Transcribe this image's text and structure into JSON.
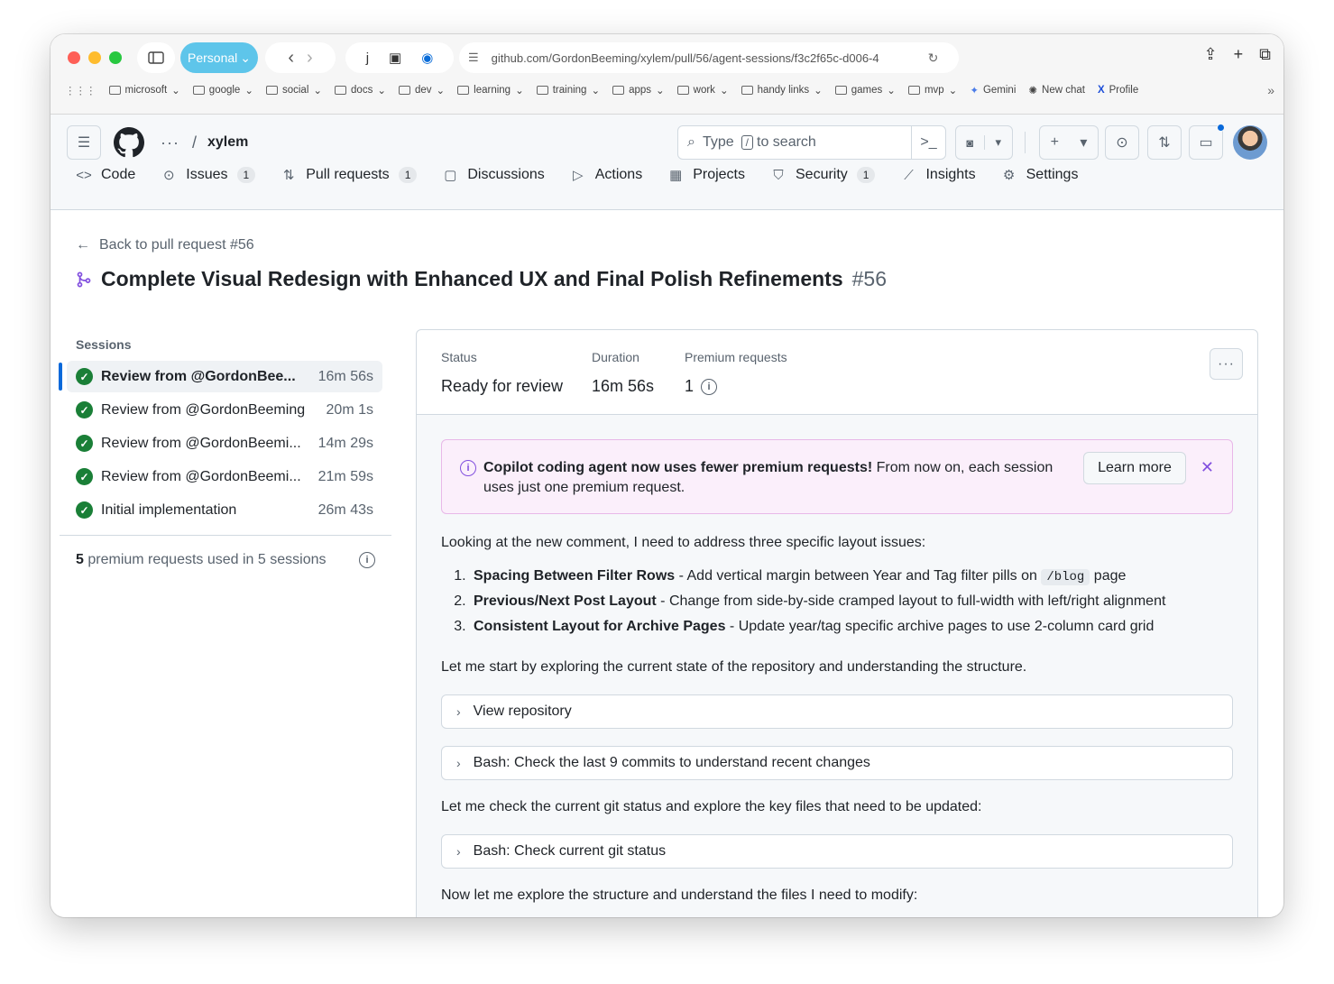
{
  "browser": {
    "profile": "Personal",
    "url": "github.com/GordonBeeming/xylem/pull/56/agent-sessions/f3c2f65c-d006-4",
    "ext_letter": "j",
    "bookmarks": [
      "microsoft",
      "google",
      "social",
      "docs",
      "dev",
      "learning",
      "training",
      "apps",
      "work",
      "handy links",
      "games",
      "mvp"
    ],
    "links": [
      "Gemini",
      "New chat",
      "Profile"
    ]
  },
  "header": {
    "repo": "xylem",
    "search_placeholder_pre": "Type",
    "search_key": "/",
    "search_placeholder_post": "to search",
    "tabs": [
      {
        "label": "Code",
        "icon": "code-icon",
        "count": ""
      },
      {
        "label": "Issues",
        "icon": "issue-icon",
        "count": "1"
      },
      {
        "label": "Pull requests",
        "icon": "pull-request-icon",
        "count": "1"
      },
      {
        "label": "Discussions",
        "icon": "discussion-icon",
        "count": ""
      },
      {
        "label": "Actions",
        "icon": "play-icon",
        "count": ""
      },
      {
        "label": "Projects",
        "icon": "table-icon",
        "count": ""
      },
      {
        "label": "Security",
        "icon": "shield-icon",
        "count": "1"
      },
      {
        "label": "Insights",
        "icon": "graph-icon",
        "count": ""
      },
      {
        "label": "Settings",
        "icon": "gear-icon",
        "count": ""
      }
    ]
  },
  "page": {
    "back_link": "Back to pull request #56",
    "title": "Complete Visual Redesign with Enhanced UX and Final Polish Refinements",
    "number": "#56"
  },
  "sessions": {
    "title": "Sessions",
    "items": [
      {
        "label": "Review from @GordonBee...",
        "time": "16m 56s"
      },
      {
        "label": "Review from @GordonBeeming",
        "time": "20m 1s"
      },
      {
        "label": "Review from @GordonBeemi...",
        "time": "14m 29s"
      },
      {
        "label": "Review from @GordonBeemi...",
        "time": "21m 59s"
      },
      {
        "label": "Initial implementation",
        "time": "26m 43s"
      }
    ],
    "summary_count": "5",
    "summary_text": "premium requests used in 5 sessions"
  },
  "details": {
    "status_label": "Status",
    "status_value": "Ready for review",
    "duration_label": "Duration",
    "duration_value": "16m 56s",
    "premium_label": "Premium requests",
    "premium_value": "1"
  },
  "banner": {
    "bold": "Copilot coding agent now uses fewer premium requests!",
    "text": " From now on, each session uses just one premium request.",
    "button": "Learn more"
  },
  "log": {
    "intro": "Looking at the new comment, I need to address three specific layout issues:",
    "items": [
      {
        "bold": "Spacing Between Filter Rows",
        "text_pre": " - Add vertical margin between Year and Tag filter pills on ",
        "code": "/blog",
        "text_post": " page"
      },
      {
        "bold": "Previous/Next Post Layout",
        "text_pre": " - Change from side-by-side cramped layout to full-width with left/right alignment",
        "code": "",
        "text_post": ""
      },
      {
        "bold": "Consistent Layout for Archive Pages",
        "text_pre": " - Update year/tag specific archive pages to use 2-column card grid",
        "code": "",
        "text_post": ""
      }
    ],
    "para2": "Let me start by exploring the current state of the repository and understanding the structure.",
    "collapse1": "View repository",
    "collapse2": "Bash: Check the last 9 commits to understand recent changes",
    "para3": "Let me check the current git status and explore the key files that need to be updated:",
    "collapse3": "Bash: Check current git status",
    "para4": "Now let me explore the structure and understand the files I need to modify:"
  },
  "colors": {
    "accent": "#0969da",
    "success": "#1a7f37",
    "banner_bg": "#fbeffb",
    "copilot_purple": "#8250df"
  }
}
